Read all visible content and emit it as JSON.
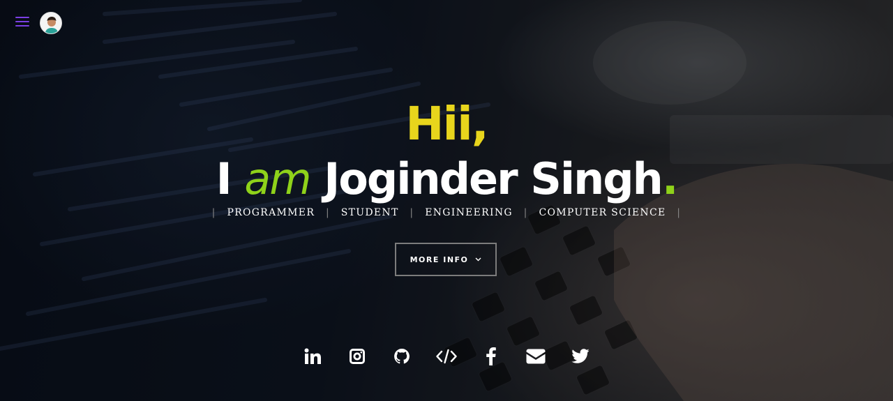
{
  "hero": {
    "greeting": "Hii,",
    "name_prefix": "I ",
    "name_am": "am",
    "name": " Joginder Singh",
    "name_dot": ".",
    "tags": [
      "PROGRAMMER",
      "STUDENT",
      "ENGINEERING",
      "COMPUTER SCIENCE"
    ],
    "sep": "|",
    "more_info_label": "MORE INFO",
    "more_info_icon": "chevron-down-icon"
  },
  "nav": {
    "menu_icon": "hamburger-menu-icon",
    "avatar_icon": "profile-avatar"
  },
  "socials": [
    {
      "icon": "linkedin-icon"
    },
    {
      "icon": "instagram-icon"
    },
    {
      "icon": "github-icon"
    },
    {
      "icon": "code-icon"
    },
    {
      "icon": "facebook-icon"
    },
    {
      "icon": "envelope-icon"
    },
    {
      "icon": "twitter-icon"
    }
  ],
  "colors": {
    "greeting": "#e8d51c",
    "accent": "#8fd21a",
    "menu": "#7b3fe4",
    "text": "#ffffff"
  }
}
